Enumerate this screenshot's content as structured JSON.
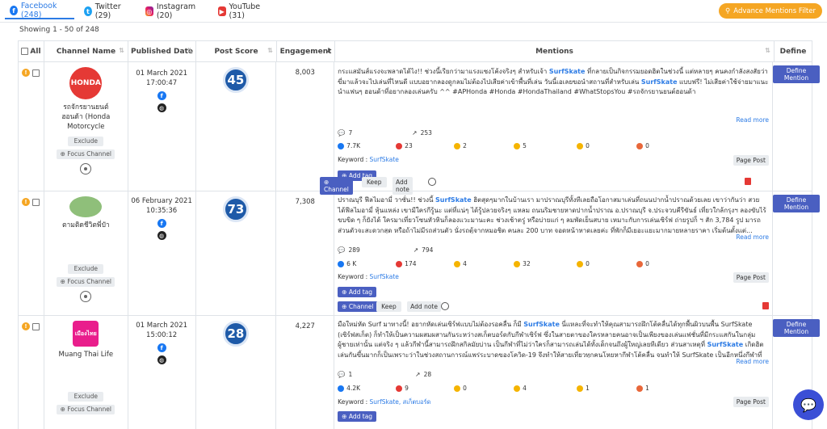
{
  "tabs": [
    {
      "label": "Facebook (248)",
      "icon": "facebook-icon",
      "active": true
    },
    {
      "label": "Twitter (29)",
      "icon": "twitter-icon",
      "active": false
    },
    {
      "label": "Instagram (20)",
      "icon": "instagram-icon",
      "active": false
    },
    {
      "label": "YouTube (31)",
      "icon": "youtube-icon",
      "active": false
    }
  ],
  "advance_filter_label": "Advance Mentions Filter",
  "showing_text": "Showing 1 - 50 of 248",
  "columns": {
    "all": "All",
    "channel_name": "Channel Name",
    "published_date": "Published Date",
    "post_score": "Post Score",
    "engagement": "Engagement",
    "mentions": "Mentions",
    "define": "Define"
  },
  "labels": {
    "exclude": "Exclude",
    "focus_channel": "Focus Channel",
    "read_more": "Read more",
    "keyword_prefix": "Keyword :",
    "page_post": "Page Post",
    "add_tag": "Add tag",
    "channel": "Channel",
    "keep": "Keep",
    "add_note": "Add note",
    "define_mention": "Define Mention"
  },
  "rows": [
    {
      "channel": "รถจักรยานยนต์ฮอนด้า (Honda Motorcycle)",
      "channel_line1": "รถจักรยานยนต์",
      "channel_line2": "ฮอนด้า (Honda",
      "channel_line3": "Motorcycle",
      "logo_color": "#e53935",
      "logo_text": "HONDA",
      "date": "01 March 2021",
      "time": "17:00:47",
      "score": "45",
      "engagement": "8,003",
      "text_pre": "กระแสมันส์แรงจะพลาดได้ไง!! ช่วงนี้เรียกว่ามาแรงแซงโค้งจริงๆ สำหรับเจ้า ",
      "kw1": "SurfSkate",
      "text_mid": " ที่กลายเป็นกิจกรรมยอดฮิตในช่วงนี้ แต่หลายๆ คนคงกำลังสงสัยว่าขี่มาแล้วจะไปเล่นที่ไหนดี แบบอยากลองดูกลมไม่ต้องไปเสียค่าเข้าพื้นที่เล่น วันนี้เอเลยขอนำสถานที่สำหรับเล่น ",
      "kw2": "SurfSkate",
      "text_post": " แบบฟรี! ไม่เสียค่าใช้จ่ายมาแนะนำแฟนๆ ฮอนด้าที่อยากลองเล่นครับ ^^ #APHonda #Honda #HondaThailand #WhatStopsYou #รถจักรยานยนต์ฮอนด้า",
      "comments": "7",
      "shares": "253",
      "likes": "7.7K",
      "love": "23",
      "haha": "2",
      "wow": "5",
      "sad": "0",
      "angry": "0",
      "keyword": "SurfSkate"
    },
    {
      "channel": "ตามติดชีวิตพี่ป๋า",
      "channel_line1": "ตามติดชีวิตพี่ป๋า",
      "channel_line2": "",
      "channel_line3": "",
      "logo_color": "#8fbf7a",
      "logo_text": "",
      "date": "06 February 2021",
      "time": "10:35:36",
      "score": "73",
      "engagement": "7,308",
      "text_pre": "ปราณบุรี ฟีลไมอามี่ วาซั่น!! ช่วงนี้ ",
      "kw1": "SurfSkate",
      "text_mid": " ฮิตสุดๆมากในบ้านเรา มาปราณบุรีทั้งทีเลยถือโอกาสมาเล่นที่ถนนปากน้ำปราณด้วยเลย เขาว่ากันว่า สวย ได้ฟีลไมอามี่ หุ้นแหล่ง เขามีใครกีรู้นะ แต่ที่แน่ๆ ได้รู้ปลวยจริงๆ แหลม ถนนริมชายหาดปากน้ำปราณ อ.ปราณบุรี จ.ประจวบคีรีขันธ์ เที่ยวใกล้กรุงฯ ลองขับไร้ขบขิด ๆ ก็ยังได้ ใครมาเที่ยวโซนหัวหินก็ลองแวะมานะคะ ช่วงเช้าตรู่ หรือบ่ายแก่ ๆ ลมพัดเย็นสบาย เหมาะกับการเล่นเซิร์ฟ ถ่ายรูปก็ ฯ สัก 3,784 รูป มารถส่วนตัวจะสะดวกสุด หรือถ้าไม่มีรถส่วนตัว นั่งรถตู้จากหมอชิต คนละ 200 บาท จอดหน้าหาดเลยค่ะ ที่พักก็มีเยอะแยะมากมายหลายราคา เริ่มต้นตั้งแต่...",
      "kw2": "",
      "text_post": "",
      "comments": "289",
      "shares": "794",
      "likes": "6 K",
      "love": "174",
      "haha": "4",
      "wow": "32",
      "sad": "0",
      "angry": "0",
      "keyword": "SurfSkate"
    },
    {
      "channel": "Muang Thai Life",
      "channel_line1": "Muang Thai Life",
      "channel_line2": "",
      "channel_line3": "",
      "logo_color": "#e91e8c",
      "logo_text": "เมืองไทย",
      "date": "01 March 2021",
      "time": "15:00:12",
      "score": "28",
      "engagement": "4,227",
      "text_pre": "มือใหม่หัด Surf มาทางนี้! อยากหัดเล่นเซิร์ฟแบบไม่ต้องรอคลื่น ก็มี ",
      "kw1": "SurfSkate",
      "text_mid": " นี่แหละที่จะทำให้คุณสามารถฝึกโต้คลื่นได้ทุกพื้นผิวบนพื้น SurfSkate (เซิร์ฟสเก็ต) ก็ทำให้เป็นความผสมผสานกันระหว่างสเก็ตบอร์ดกับกีฬาเซิร์ฟ ซึ่งในสายตาของใครหลายคนอาจเป็นเพียงของเล่นแฟชั่นที่มีกระแสกันในกลุ่มผู้ชายเท่านั้น แต่จริง ๆ แล้วกีฬานี้สามารถฝึกสกิลมัยบ่าน เป็นกีฬาที่ไม่ว่าใครก็สามารถเล่นได้ทั้งเด็กจนถึงผู้ใหญ่เลยทีเดียว ส่วนสาเหตุที่ ",
      "kw2": "SurfSkate",
      "text_post": " เกิดฮิตเล่นกันขึ้นมากก็เป็นเพราะว่าในช่วงสถานการณ์แพร่ระบาดของโควิด-19 จึงทำให้สายเที่ยวทุกคนโหยหากีฬาโต้คลื่น จนทำให้ SurfSkate เป็นอีกหนึ่งกีฬาที่คนหัน...",
      "comments": "1",
      "shares": "28",
      "likes": "4.2K",
      "love": "9",
      "haha": "0",
      "wow": "4",
      "sad": "1",
      "angry": "1",
      "keyword": "SurfSkate, สเก็ตบอร์ด"
    }
  ]
}
